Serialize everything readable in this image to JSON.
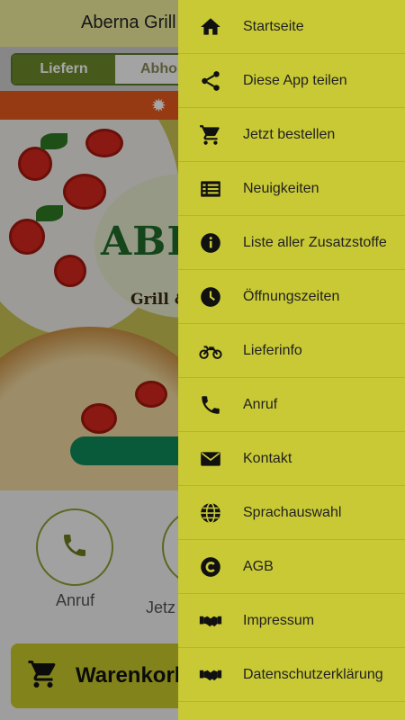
{
  "app": {
    "title": "Aberna Grill &",
    "tabs": {
      "deliver": "Liefern",
      "pickup": "Abho"
    },
    "logo": {
      "main": "ABE",
      "sub": "Grill &"
    },
    "quick_actions": [
      {
        "label": "Anruf",
        "icon": "phone-icon"
      },
      {
        "label": "Jetz",
        "icon": "cart-icon"
      }
    ],
    "cart_label": "Warenkorb"
  },
  "drawer": {
    "items": [
      {
        "label": "Startseite",
        "icon": "home-icon"
      },
      {
        "label": "Diese App teilen",
        "icon": "share-icon"
      },
      {
        "label": "Jetzt bestellen",
        "icon": "cart-icon"
      },
      {
        "label": "Neuigkeiten",
        "icon": "news-icon"
      },
      {
        "label": "Liste aller Zusatzstoffe",
        "icon": "info-icon"
      },
      {
        "label": "Öffnungszeiten",
        "icon": "clock-icon"
      },
      {
        "label": "Lieferinfo",
        "icon": "motorcycle-icon"
      },
      {
        "label": "Anruf",
        "icon": "phone-icon"
      },
      {
        "label": "Kontakt",
        "icon": "mail-icon"
      },
      {
        "label": "Sprachauswahl",
        "icon": "globe-icon"
      },
      {
        "label": "AGB",
        "icon": "copyright-icon"
      },
      {
        "label": "Impressum",
        "icon": "handshake-icon"
      },
      {
        "label": "Datenschutzerklärung",
        "icon": "handshake-icon"
      }
    ]
  },
  "colors": {
    "drawer_bg": "#c9c935",
    "topbar_bg": "#f0ef9c",
    "banner": "#e65a1f",
    "tab_active": "#6d8a2a"
  }
}
